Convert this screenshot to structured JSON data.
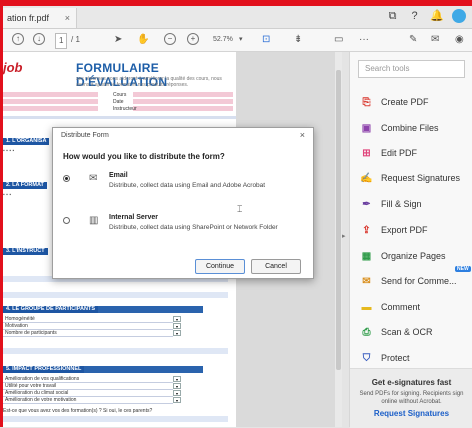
{
  "window": {
    "tab_title": "ation fr.pdf",
    "tab_close": "×",
    "page_current": "1",
    "page_total": "/ 1",
    "zoom": "52.7%",
    "more": "···"
  },
  "document": {
    "logo": "job",
    "title": "FORMULAIRE D'ÉVALUATION",
    "subtitle": "ses réponses nous aideront à améliorer la qualité des cours, nous avons à ajuster le format et nos produits réponses.",
    "fields": [
      "Cours",
      "Date",
      "Instructeur"
    ],
    "sections": [
      "1. L'ORGANISA",
      "2. LA FORMAT",
      "3. L'INSTRUCT",
      "4. LE GROUPE DE PARTICIPANTS",
      "5. IMPACT PROFESSIONNEL"
    ],
    "group_rows": [
      "Homogénéité",
      "Motivation",
      "Nombre de participants"
    ],
    "impact_rows": [
      "Amélioration de vos qualifications",
      "Utilité pour votre travail",
      "Amélioration du climat social",
      "Amélioration de votre motivation"
    ],
    "footer_q": "Est-ce que vous avez vos des formation(s) ? Si oui, le ces parents?"
  },
  "dialog": {
    "title": "Distribute Form",
    "close": "×",
    "question": "How would you like to distribute the form?",
    "options": [
      {
        "title": "Email",
        "desc": "Distribute, collect data using Email and Adobe Acrobat",
        "selected": true
      },
      {
        "title": "Internal Server",
        "desc": "Distribute, collect data using SharePoint or Network Folder",
        "selected": false
      }
    ],
    "continue_label": "Continue",
    "cancel_label": "Cancel"
  },
  "tools_panel": {
    "search_placeholder": "Search tools",
    "items": [
      {
        "label": "Create PDF",
        "icon": "create-pdf-icon",
        "color": "#d9342b"
      },
      {
        "label": "Combine Files",
        "icon": "combine-files-icon",
        "color": "#8e44ad"
      },
      {
        "label": "Edit PDF",
        "icon": "edit-pdf-icon",
        "color": "#e0457b"
      },
      {
        "label": "Request Signatures",
        "icon": "request-signatures-icon",
        "color": "#8e44ad"
      },
      {
        "label": "Fill & Sign",
        "icon": "fill-sign-icon",
        "color": "#6b3fa0"
      },
      {
        "label": "Export PDF",
        "icon": "export-pdf-icon",
        "color": "#d9342b"
      },
      {
        "label": "Organize Pages",
        "icon": "organize-pages-icon",
        "color": "#2e9b48"
      },
      {
        "label": "Send for Comme...",
        "icon": "send-comment-icon",
        "color": "#d98e1b",
        "badge": "NEW"
      },
      {
        "label": "Comment",
        "icon": "comment-icon",
        "color": "#e6b91e"
      },
      {
        "label": "Scan & OCR",
        "icon": "scan-ocr-icon",
        "color": "#2e9b48"
      },
      {
        "label": "Protect",
        "icon": "protect-icon",
        "color": "#3b5fc0"
      }
    ],
    "promo": {
      "title": "Get e-signatures fast",
      "desc": "Send PDFs for signing. Recipients sign online without Acrobat.",
      "link": "Request Signatures"
    }
  },
  "colors": {
    "accent": "#1a5ec8",
    "adobe_red": "#e2101c",
    "doc_blue": "#1e56a3"
  }
}
